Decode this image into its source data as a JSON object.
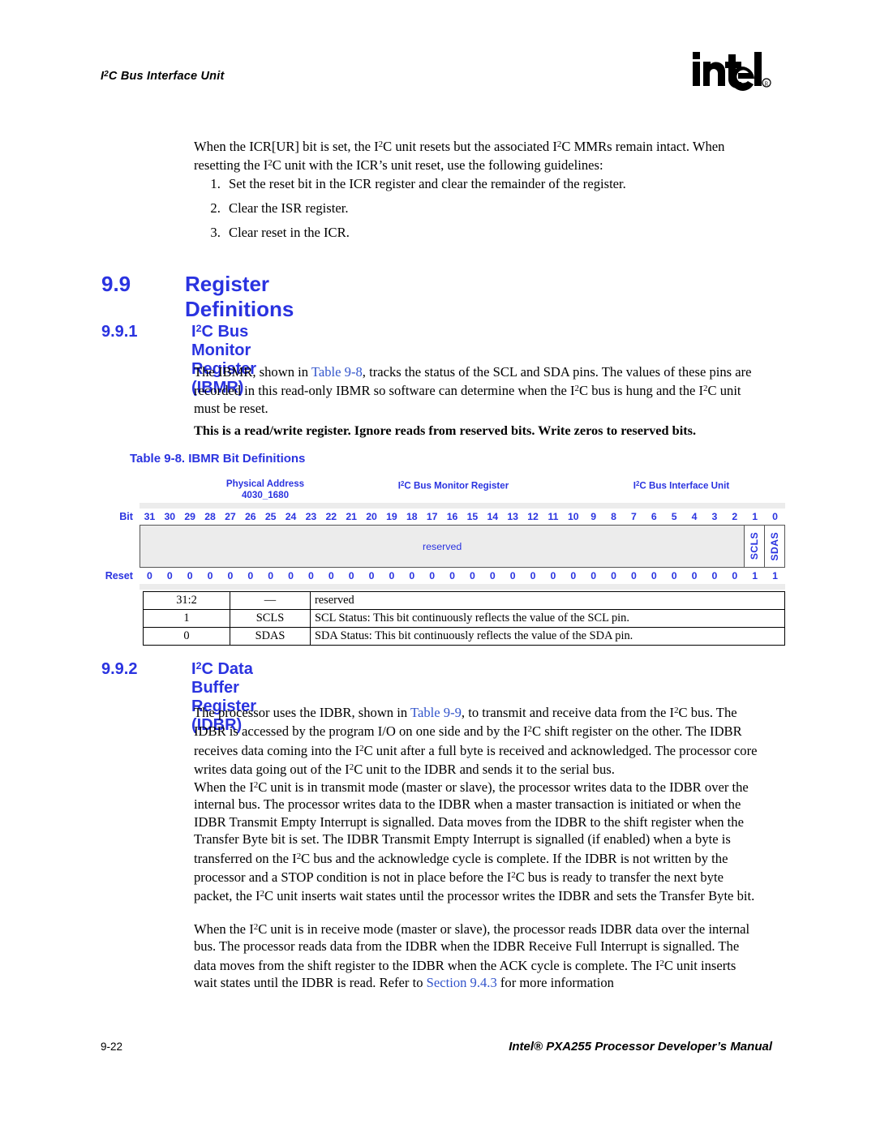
{
  "header": {
    "running_title_pre": "I",
    "running_title_sup": "2",
    "running_title_post": "C Bus Interface Unit",
    "logo_text": "intel",
    "logo_mark": "registered-trademark"
  },
  "intro": {
    "paragraph": "When the ICR[UR] bit is set, the I2C unit resets but the associated I2C MMRs remain intact. When resetting the I2C unit with the ICR’s unit reset, use the following guidelines:",
    "steps": [
      "Set the reset bit in the ICR register and clear the remainder of the register.",
      "Clear the ISR register.",
      "Clear reset in the ICR."
    ]
  },
  "sections": {
    "s99": {
      "number": "9.9",
      "title": "Register Definitions"
    },
    "s991": {
      "number": "9.9.1",
      "title_pre": "I",
      "title_sup": "2",
      "title_post": "C Bus Monitor Register (IBMR)"
    },
    "s992": {
      "number": "9.9.2",
      "title_pre": "I",
      "title_sup": "2",
      "title_post": "C Data Buffer Register (IDBR)"
    }
  },
  "ibmr": {
    "paragraph": "The IBMR, shown in Table 9-8, tracks the status of the SCL and SDA pins. The values of these pins are recorded in this read-only IBMR so software can determine when the I2C bus is hung and the I2C unit must be reset.",
    "link_label": "Table 9-8",
    "bold_note": "This is a read/write register. Ignore reads from reserved bits. Write zeros to reserved bits."
  },
  "table_9_8": {
    "caption": "Table 9-8.  IBMR Bit Definitions",
    "headers": {
      "physical_address_label": "Physical Address",
      "physical_address_value": "4030_1680",
      "register_name_pre": "I",
      "register_name_sup": "2",
      "register_name_post": "C Bus Monitor Register",
      "unit_pre": "I",
      "unit_sup": "2",
      "unit_post": "C Bus Interface Unit"
    },
    "bit_row_label": "Bit",
    "reset_row_label": "Reset",
    "bit_numbers": [
      31,
      30,
      29,
      28,
      27,
      26,
      25,
      24,
      23,
      22,
      21,
      20,
      19,
      18,
      17,
      16,
      15,
      14,
      13,
      12,
      11,
      10,
      9,
      8,
      7,
      6,
      5,
      4,
      3,
      2,
      1,
      0
    ],
    "reset_values": [
      0,
      0,
      0,
      0,
      0,
      0,
      0,
      0,
      0,
      0,
      0,
      0,
      0,
      0,
      0,
      0,
      0,
      0,
      0,
      0,
      0,
      0,
      0,
      0,
      0,
      0,
      0,
      0,
      0,
      0,
      1,
      1
    ],
    "reserved_field_label": "reserved",
    "named_fields": [
      {
        "name": "SCLS",
        "bit": 1
      },
      {
        "name": "SDAS",
        "bit": 0
      }
    ],
    "rows": [
      {
        "bits": "31:2",
        "name": "—",
        "description": "reserved"
      },
      {
        "bits": "1",
        "name": "SCLS",
        "description": "SCL Status: This bit continuously reflects the value of the SCL pin."
      },
      {
        "bits": "0",
        "name": "SDAS",
        "description": "SDA Status: This bit continuously reflects the value of the SDA pin."
      }
    ]
  },
  "idbr": {
    "p1": "The processor uses the IDBR, shown in Table 9-9, to transmit and receive data from the I2C bus. The IDBR is accessed by the program I/O on one side and by the I2C shift register on the other. The IDBR receives data coming into the I2C unit after a full byte is received and acknowledged. The processor core writes data going out of the I2C unit to the IDBR and sends it to the serial bus.",
    "p1_link": "Table 9-9",
    "p2": "When the I2C unit is in transmit mode (master or slave), the processor writes data to the IDBR over the internal bus. The processor writes data to the IDBR when a master transaction is initiated or when the IDBR Transmit Empty Interrupt is signalled. Data moves from the IDBR to the shift register when the Transfer Byte bit is set. The IDBR Transmit Empty Interrupt is signalled (if enabled) when a byte is transferred on the I2C bus and the acknowledge cycle is complete. If the IDBR is not written by the processor and a STOP condition is not in place before the I2C bus is ready to transfer the next byte packet, the I2C unit inserts wait states until the processor writes the IDBR and sets the Transfer Byte bit.",
    "p3": "When the I2C unit is in receive mode (master or slave), the processor reads IDBR data over the internal bus. The processor reads data from the IDBR when the IDBR Receive Full Interrupt is signalled. The data moves from the shift register to the IDBR when the ACK cycle is complete. The I2C unit inserts wait states until the IDBR is read. Refer to Section 9.4.3 for more information",
    "p3_link": "Section 9.4.3"
  },
  "footer": {
    "page_number": "9-22",
    "manual_title": "Intel® PXA255 Processor Developer’s Manual"
  },
  "colors": {
    "heading_blue": "#2a33e0",
    "link_blue": "#3355cc",
    "field_fill": "#ececec"
  }
}
